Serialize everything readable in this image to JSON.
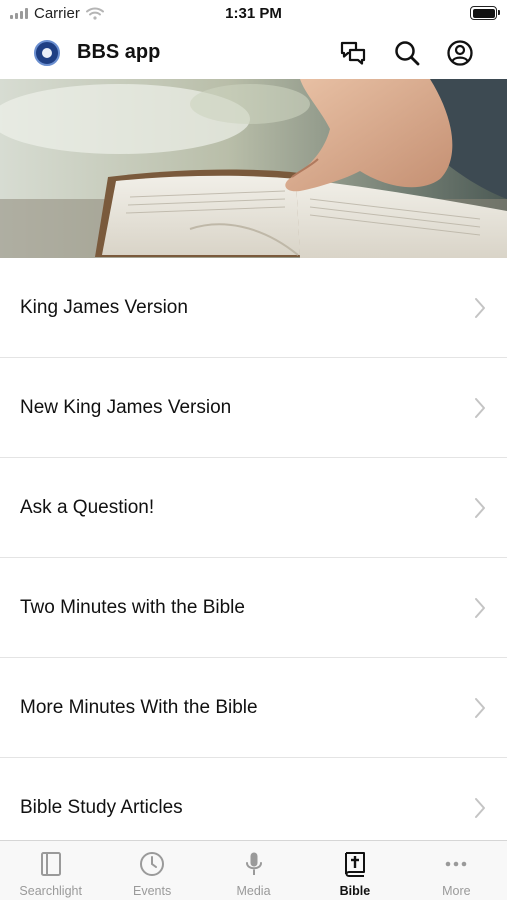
{
  "status_bar": {
    "carrier": "Carrier",
    "time": "1:31 PM"
  },
  "header": {
    "title": "BBS app",
    "icons": [
      "chat-bubbles-icon",
      "search-icon",
      "account-icon"
    ]
  },
  "hero": {
    "image": "hand-on-open-bible-photo"
  },
  "list": {
    "items": [
      {
        "label": "King James Version"
      },
      {
        "label": "New King James Version"
      },
      {
        "label": "Ask a Question!"
      },
      {
        "label": "Two Minutes with the Bible"
      },
      {
        "label": "More Minutes With the Bible"
      },
      {
        "label": "Bible Study Articles"
      }
    ]
  },
  "tabbar": {
    "tabs": [
      {
        "label": "Searchlight",
        "icon": "book-sidebar-icon",
        "active": false
      },
      {
        "label": "Events",
        "icon": "clock-icon",
        "active": false
      },
      {
        "label": "Media",
        "icon": "microphone-icon",
        "active": false
      },
      {
        "label": "Bible",
        "icon": "bible-cross-icon",
        "active": true
      },
      {
        "label": "More",
        "icon": "more-dots-icon",
        "active": false
      }
    ]
  },
  "colors": {
    "active_tab": "#111111",
    "inactive_tab": "#9a9a9a",
    "divider": "#e4e4e4",
    "logo": "#1f3f84"
  }
}
